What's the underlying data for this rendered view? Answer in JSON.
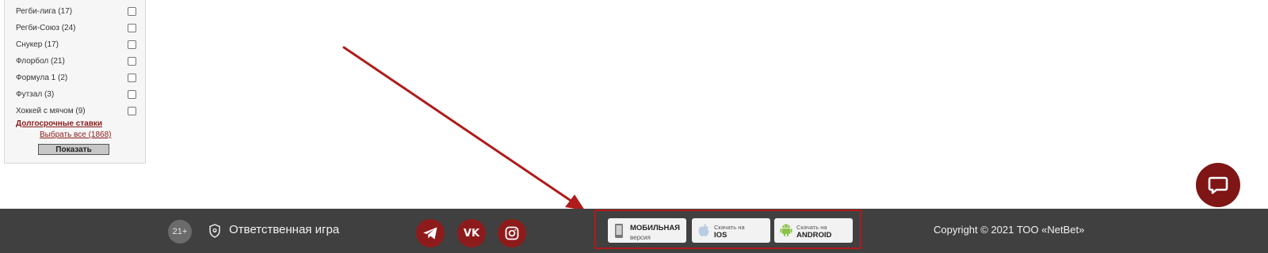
{
  "sidebar": {
    "items": [
      {
        "label": "Регби-лига (17)"
      },
      {
        "label": "Регби-Союз (24)"
      },
      {
        "label": "Снукер (17)"
      },
      {
        "label": "Флорбол (21)"
      },
      {
        "label": "Формула 1 (2)"
      },
      {
        "label": "Футзал (3)"
      },
      {
        "label": "Хоккей с мячом (9)"
      }
    ],
    "long_term_label": "Долгосрочные ставки",
    "select_all_label": "Выбрать все (1868)",
    "show_button_label": "Показать"
  },
  "footer": {
    "age_badge": "21+",
    "responsible_game": "Ответственная игра",
    "social": {
      "telegram_icon": "telegram-icon",
      "vk_text": "VK",
      "instagram_icon": "instagram-icon"
    },
    "apps": {
      "mobile": {
        "line1": "МОБИЛЬНАЯ",
        "line2": "версия"
      },
      "ios": {
        "line1": "Скачать на",
        "line2": "IOS"
      },
      "android": {
        "line1": "Скачать на",
        "line2": "ANDROID"
      }
    },
    "copyright": "Copyright © 2021 ТОО «NetBet»"
  },
  "colors": {
    "footer_bg": "#404040",
    "brand_red": "#8e1b1b",
    "annotation_red": "#b01b1b"
  }
}
